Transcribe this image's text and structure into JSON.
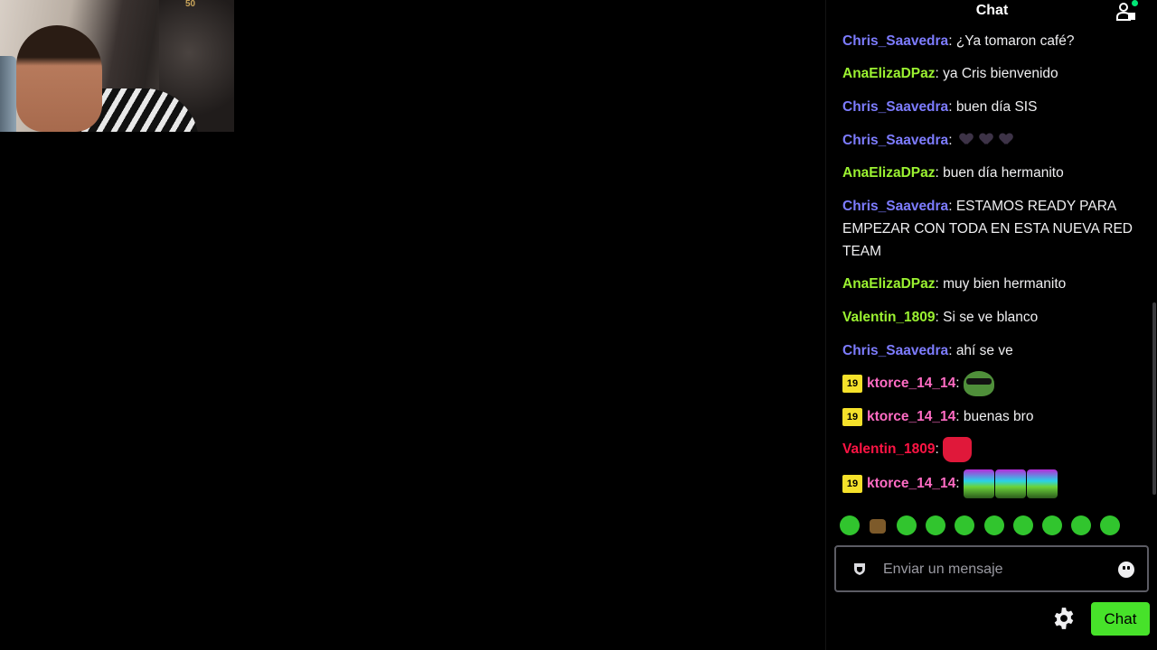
{
  "colors": {
    "chris": "#7d7cff",
    "ana": "#9bf231",
    "valentin_green": "#9bf231",
    "valentin_red": "#ff1444",
    "ktorce": "#ff6cc4",
    "badge": "#f5e12a",
    "chat_button": "#47e22a",
    "background": "#000000"
  },
  "webcam": {
    "poster_text": "50"
  },
  "chat": {
    "title": "Chat",
    "messages": [
      {
        "user": "Chris_Saavedra",
        "color": "#7d7cff",
        "text": "¿Ya tomaron café?"
      },
      {
        "user": "AnaElizaDPaz",
        "color": "#9bf231",
        "text": "ya Cris bienvenido"
      },
      {
        "user": "Chris_Saavedra",
        "color": "#7d7cff",
        "text": "buen día SIS"
      },
      {
        "user": "Chris_Saavedra",
        "color": "#7d7cff",
        "text": "",
        "emotes": [
          "purple-heart-icon",
          "purple-heart-icon",
          "purple-heart-icon"
        ]
      },
      {
        "user": "AnaElizaDPaz",
        "color": "#9bf231",
        "text": "buen día hermanito"
      },
      {
        "user": "Chris_Saavedra",
        "color": "#7d7cff",
        "text": "ESTAMOS READY PARA EMPEZAR CON TODA EN ESTA NUEVA RED TEAM"
      },
      {
        "user": "AnaElizaDPaz",
        "color": "#9bf231",
        "text": "muy bien hermanito"
      },
      {
        "user": "Valentin_1809",
        "color": "#9bf231",
        "text": "Si se ve blanco"
      },
      {
        "user": "Chris_Saavedra",
        "color": "#7d7cff",
        "text": "ahí se ve"
      },
      {
        "badge": "19",
        "user": "ktorce_14_14",
        "color": "#ff6cc4",
        "text": "",
        "emotes": [
          "pepe-sunglasses-emote"
        ]
      },
      {
        "badge": "19",
        "user": "ktorce_14_14",
        "color": "#ff6cc4",
        "text": "buenas bro"
      },
      {
        "user": "Valentin_1809",
        "color": "#ff1444",
        "text": "",
        "emotes": [
          "red-cat-emote"
        ]
      },
      {
        "badge": "19",
        "user": "ktorce_14_14",
        "color": "#ff6cc4",
        "text": "",
        "emotes": [
          "rave-emote",
          "rave-emote",
          "rave-emote"
        ]
      }
    ],
    "input": {
      "placeholder": "Enviar un mensaje",
      "value": ""
    },
    "send_label": "Chat",
    "emote_bar": [
      "halo-emote",
      "box-emote",
      "blob-emote",
      "blob-emote",
      "blob-emote",
      "blob-emote",
      "blob-emote",
      "blob-emote",
      "blob-emote",
      "blob-emote"
    ]
  }
}
